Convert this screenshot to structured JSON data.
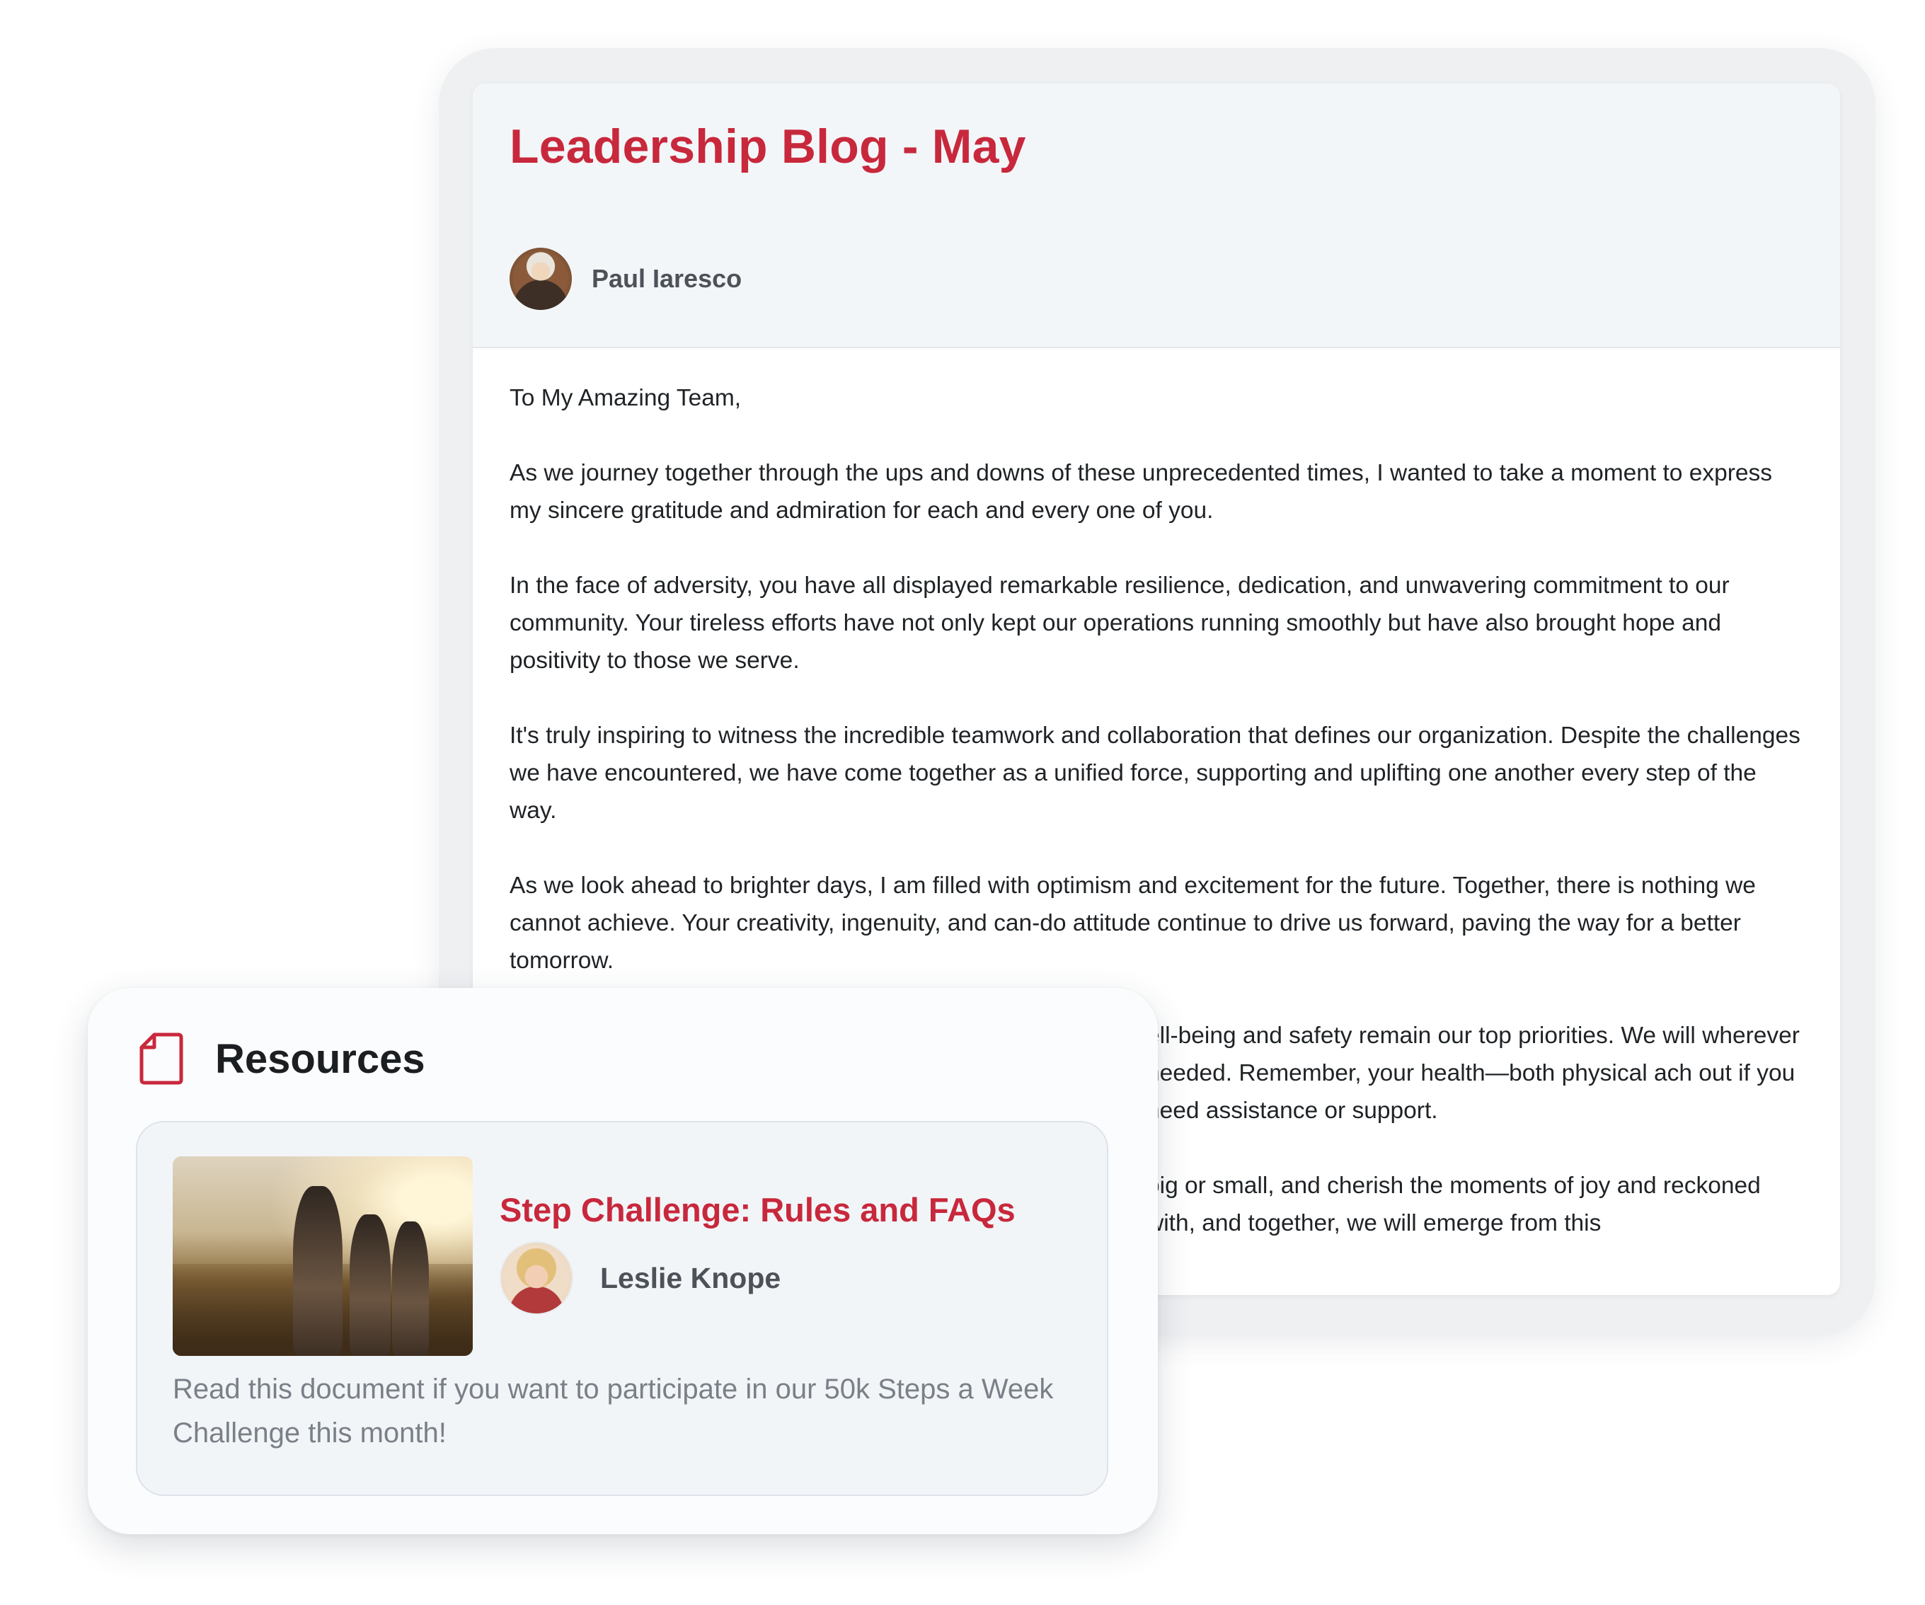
{
  "blog": {
    "title": "Leadership Blog - May",
    "author": {
      "name": "Paul Iaresco",
      "avatar": "author-photo"
    },
    "body": [
      "To My Amazing Team,",
      "As we journey together through the ups and downs of these unprecedented times, I wanted to take a moment to express my sincere gratitude and admiration for each and every one of you.",
      "In the face of adversity, you have all displayed remarkable resilience, dedication, and unwavering commitment to our community. Your tireless efforts have not only kept our operations running smoothly but have also brought hope and positivity to those we serve.",
      "It's truly inspiring to witness the incredible teamwork and collaboration that defines our organization. Despite the challenges we have encountered, we have come together as a unified force, supporting and uplifting one another every step of the way.",
      "As we look ahead to brighter days, I am filled with optimism and excitement for the future. Together, there is nothing we cannot achieve. Your creativity, ingenuity, and can-do attitude continue to drive us forward, paving the way for a better tomorrow.",
      "ell-being and safety remain our top priorities. We will wherever needed. Remember, your health—both physical ach out if you need assistance or support.",
      "big or small, and cherish the moments of joy and reckoned with, and together, we will emerge from this"
    ]
  },
  "resources": {
    "title": "Resources",
    "icon": "document-icon",
    "item": {
      "title": "Step Challenge: Rules and FAQs",
      "author": "Leslie Knope",
      "description": "Read this document if you want to participate in our 50k Steps a Week Challenge this month!",
      "image": "hikers-photo"
    }
  },
  "colors": {
    "accent": "#c8283c",
    "text": "#1f2326",
    "muted": "#7a8088"
  }
}
